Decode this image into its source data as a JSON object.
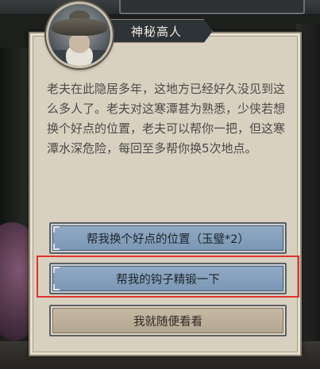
{
  "npc": {
    "name": "神秘高人",
    "dialog": "老夫在此隐居多年，这地方已经好久没见到这么多人了。老夫对这寒潭甚为熟悉，少侠若想换个好点的位置，老夫可以帮你一把，但这寒潭水深危险，每回至多帮你换5次地点。"
  },
  "options": [
    {
      "label": "帮我换个好点的位置（玉璧*2）",
      "style": "blue"
    },
    {
      "label": "帮我的钩子精锻一下",
      "style": "blue",
      "highlighted": true
    },
    {
      "label": "我就随便看看",
      "style": "tan"
    }
  ],
  "colors": {
    "panel": "#d9d1c0",
    "option_blue": "#7895b3",
    "option_tan": "#b2a58f",
    "highlight": "#e0322d"
  }
}
